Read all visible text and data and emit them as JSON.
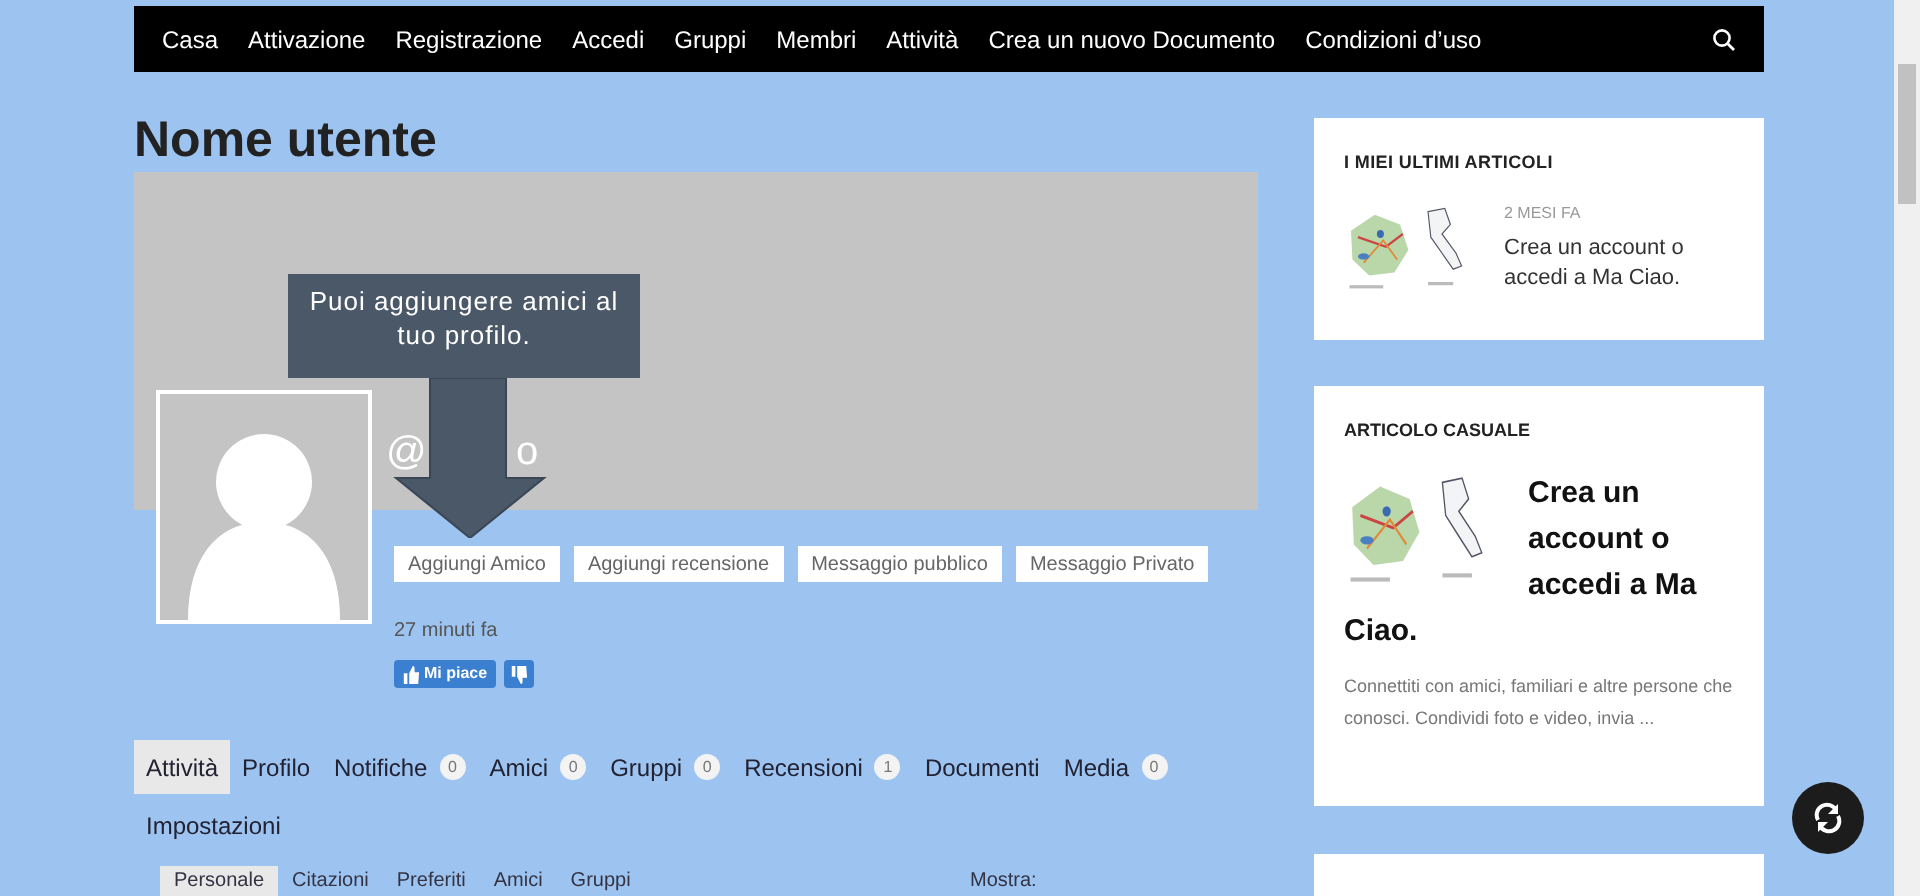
{
  "nav": {
    "items": [
      "Casa",
      "Attivazione",
      "Registrazione",
      "Accedi",
      "Gruppi",
      "Membri",
      "Attività",
      "Crea un nuovo Documento",
      "Condizioni d’uso"
    ]
  },
  "profile": {
    "title": "Nome utente",
    "handle_start": "@",
    "handle_end": "o",
    "tooltip": "Puoi aggiungere amici al tuo profilo.",
    "actions": [
      "Aggiungi Amico",
      "Aggiungi recensione",
      "Messaggio pubblico",
      "Messaggio Privato"
    ],
    "time": "27 minuti fa",
    "like": "Mi piace"
  },
  "tabs": [
    {
      "label": "Attività",
      "selected": true
    },
    {
      "label": "Profilo",
      "selected": false
    },
    {
      "label": "Notifiche",
      "count": "0",
      "selected": false
    },
    {
      "label": "Amici",
      "count": "0",
      "selected": false
    },
    {
      "label": "Gruppi",
      "count": "0",
      "selected": false
    },
    {
      "label": "Recensioni",
      "count": "1",
      "selected": false
    },
    {
      "label": "Documenti",
      "selected": false
    },
    {
      "label": "Media",
      "count": "0",
      "selected": false
    },
    {
      "label": "Impostazioni",
      "selected": false
    }
  ],
  "subtabs": [
    {
      "label": "Personale",
      "selected": true
    },
    {
      "label": "Citazioni",
      "selected": false
    },
    {
      "label": "Preferiti",
      "selected": false
    },
    {
      "label": "Amici",
      "selected": false
    },
    {
      "label": "Gruppi",
      "selected": false
    }
  ],
  "show_label": "Mostra:",
  "sidebar": {
    "latest": {
      "heading": "I MIEI ULTIMI ARTICOLI",
      "date": "2 MESI FA",
      "title": "Crea un account o accedi a Ma Ciao."
    },
    "random": {
      "heading": "ARTICOLO CASUALE",
      "title": "Crea un account o accedi a Ma Ciao.",
      "excerpt": "Connettiti con amici, familiari e altre persone che conosci. Condividi foto e video, invia ..."
    }
  }
}
